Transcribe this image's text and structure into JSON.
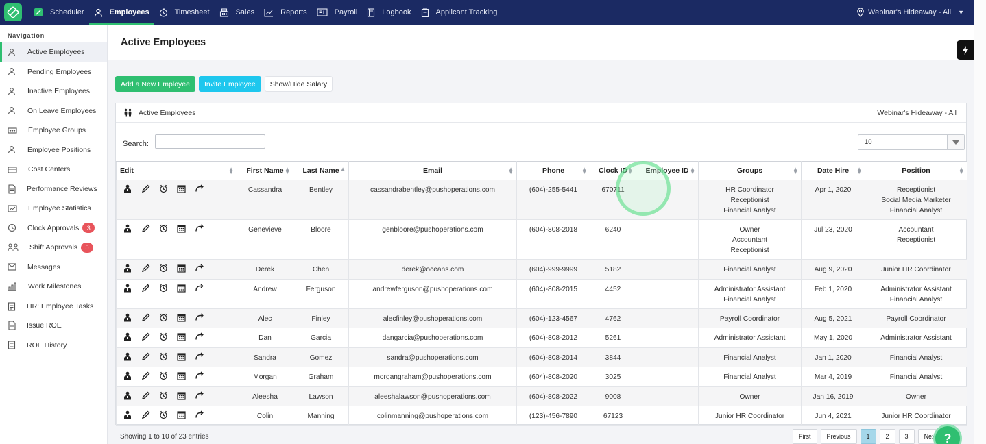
{
  "topnav": {
    "items": [
      {
        "label": "Scheduler",
        "icon": "scheduler-icon"
      },
      {
        "label": "Employees",
        "icon": "user-icon",
        "active": true
      },
      {
        "label": "Timesheet",
        "icon": "clock-icon"
      },
      {
        "label": "Sales",
        "icon": "cash-register-icon"
      },
      {
        "label": "Reports",
        "icon": "chart-icon"
      },
      {
        "label": "Payroll",
        "icon": "payroll-icon"
      },
      {
        "label": "Logbook",
        "icon": "book-icon"
      },
      {
        "label": "Applicant Tracking",
        "icon": "clipboard-icon"
      }
    ],
    "location": "Webinar's Hideaway - All"
  },
  "sidebar": {
    "heading": "Navigation",
    "items": [
      {
        "label": "Active Employees",
        "active": true
      },
      {
        "label": "Pending Employees"
      },
      {
        "label": "Inactive Employees"
      },
      {
        "label": "On Leave Employees"
      },
      {
        "label": "Employee Groups"
      },
      {
        "label": "Employee Positions"
      },
      {
        "label": "Cost Centers"
      },
      {
        "label": "Performance Reviews"
      },
      {
        "label": "Employee Statistics"
      },
      {
        "label": "Clock Approvals",
        "badge": "3"
      },
      {
        "label": "Shift Approvals",
        "badge": "5"
      },
      {
        "label": "Messages"
      },
      {
        "label": "Work Milestones"
      },
      {
        "label": "HR: Employee Tasks"
      },
      {
        "label": "Issue ROE"
      },
      {
        "label": "ROE History"
      }
    ]
  },
  "page": {
    "title": "Active Employees",
    "buttons": {
      "add": "Add a New Employee",
      "invite": "Invite Employee",
      "salary": "Show/Hide Salary"
    }
  },
  "panel": {
    "title": "Active Employees",
    "location": "Webinar's Hideaway - All",
    "search_label": "Search:",
    "search_value": "",
    "page_size": "10"
  },
  "table": {
    "columns": [
      "Edit",
      "First Name",
      "Last Name",
      "Email",
      "Phone",
      "Clock ID",
      "Employee ID",
      "Groups",
      "Date Hire",
      "Position"
    ],
    "rows": [
      {
        "first": "Cassandra",
        "last": "Bentley",
        "email": "cassandrabentley@pushoperations.com",
        "phone": "(604)-255-5441",
        "clock": "670711",
        "empid": "",
        "groups": [
          "HR Coordinator",
          "Receptionist",
          "Financial Analyst"
        ],
        "hire": "Apr 1, 2020",
        "position": [
          "Receptionist",
          "Social Media Marketer",
          "Financial Analyst"
        ]
      },
      {
        "first": "Genevieve",
        "last": "Bloore",
        "email": "genbloore@pushoperations.com",
        "phone": "(604)-808-2018",
        "clock": "6240",
        "empid": "",
        "groups": [
          "Owner",
          "Accountant",
          "Receptionist"
        ],
        "hire": "Jul 23, 2020",
        "position": [
          "Accountant",
          "Receptionist"
        ]
      },
      {
        "first": "Derek",
        "last": "Chen",
        "email": "derek@oceans.com",
        "phone": "(604)-999-9999",
        "clock": "5182",
        "empid": "",
        "groups": [
          "Financial Analyst"
        ],
        "hire": "Aug 9, 2020",
        "position": [
          "Junior HR Coordinator"
        ]
      },
      {
        "first": "Andrew",
        "last": "Ferguson",
        "email": "andrewferguson@pushoperations.com",
        "phone": "(604)-808-2015",
        "clock": "4452",
        "empid": "",
        "groups": [
          "Administrator Assistant",
          "Financial Analyst"
        ],
        "hire": "Feb 1, 2020",
        "position": [
          "Administrator Assistant",
          "Financial Analyst"
        ]
      },
      {
        "first": "Alec",
        "last": "Finley",
        "email": "alecfinley@pushoperations.com",
        "phone": "(604)-123-4567",
        "clock": "4762",
        "empid": "",
        "groups": [
          "Payroll Coordinator"
        ],
        "hire": "Aug 5, 2021",
        "position": [
          "Payroll Coordinator"
        ]
      },
      {
        "first": "Dan",
        "last": "Garcia",
        "email": "dangarcia@pushoperations.com",
        "phone": "(604)-808-2012",
        "clock": "5261",
        "empid": "",
        "groups": [
          "Administrator Assistant"
        ],
        "hire": "May 1, 2020",
        "position": [
          "Administrator Assistant"
        ]
      },
      {
        "first": "Sandra",
        "last": "Gomez",
        "email": "sandra@pushoperations.com",
        "phone": "(604)-808-2014",
        "clock": "3844",
        "empid": "",
        "groups": [
          "Financial Analyst"
        ],
        "hire": "Jan 1, 2020",
        "position": [
          "Financial Analyst"
        ]
      },
      {
        "first": "Morgan",
        "last": "Graham",
        "email": "morgangraham@pushoperations.com",
        "phone": "(604)-808-2020",
        "clock": "3025",
        "empid": "",
        "groups": [
          "Financial Analyst"
        ],
        "hire": "Mar 4, 2019",
        "position": [
          "Financial Analyst"
        ]
      },
      {
        "first": "Aleesha",
        "last": "Lawson",
        "email": "aleeshalawson@pushoperations.com",
        "phone": "(604)-808-2022",
        "clock": "9008",
        "empid": "",
        "groups": [
          "Owner"
        ],
        "hire": "Jan 16, 2019",
        "position": [
          "Owner"
        ]
      },
      {
        "first": "Colin",
        "last": "Manning",
        "email": "colinmanning@pushoperations.com",
        "phone": "(123)-456-7890",
        "clock": "67123",
        "empid": "",
        "groups": [
          "Junior HR Coordinator"
        ],
        "hire": "Jun 4, 2021",
        "position": [
          "Junior HR Coordinator"
        ]
      }
    ]
  },
  "footer": {
    "info": "Showing 1 to 10 of 23 entries",
    "pager": [
      "First",
      "Previous",
      "1",
      "2",
      "3",
      "Next"
    ],
    "current_page": "1"
  },
  "colors": {
    "topbar": "#1b2a63",
    "accent": "#2fbf71",
    "invite": "#1ec7ee",
    "badge": "#e8545b"
  }
}
